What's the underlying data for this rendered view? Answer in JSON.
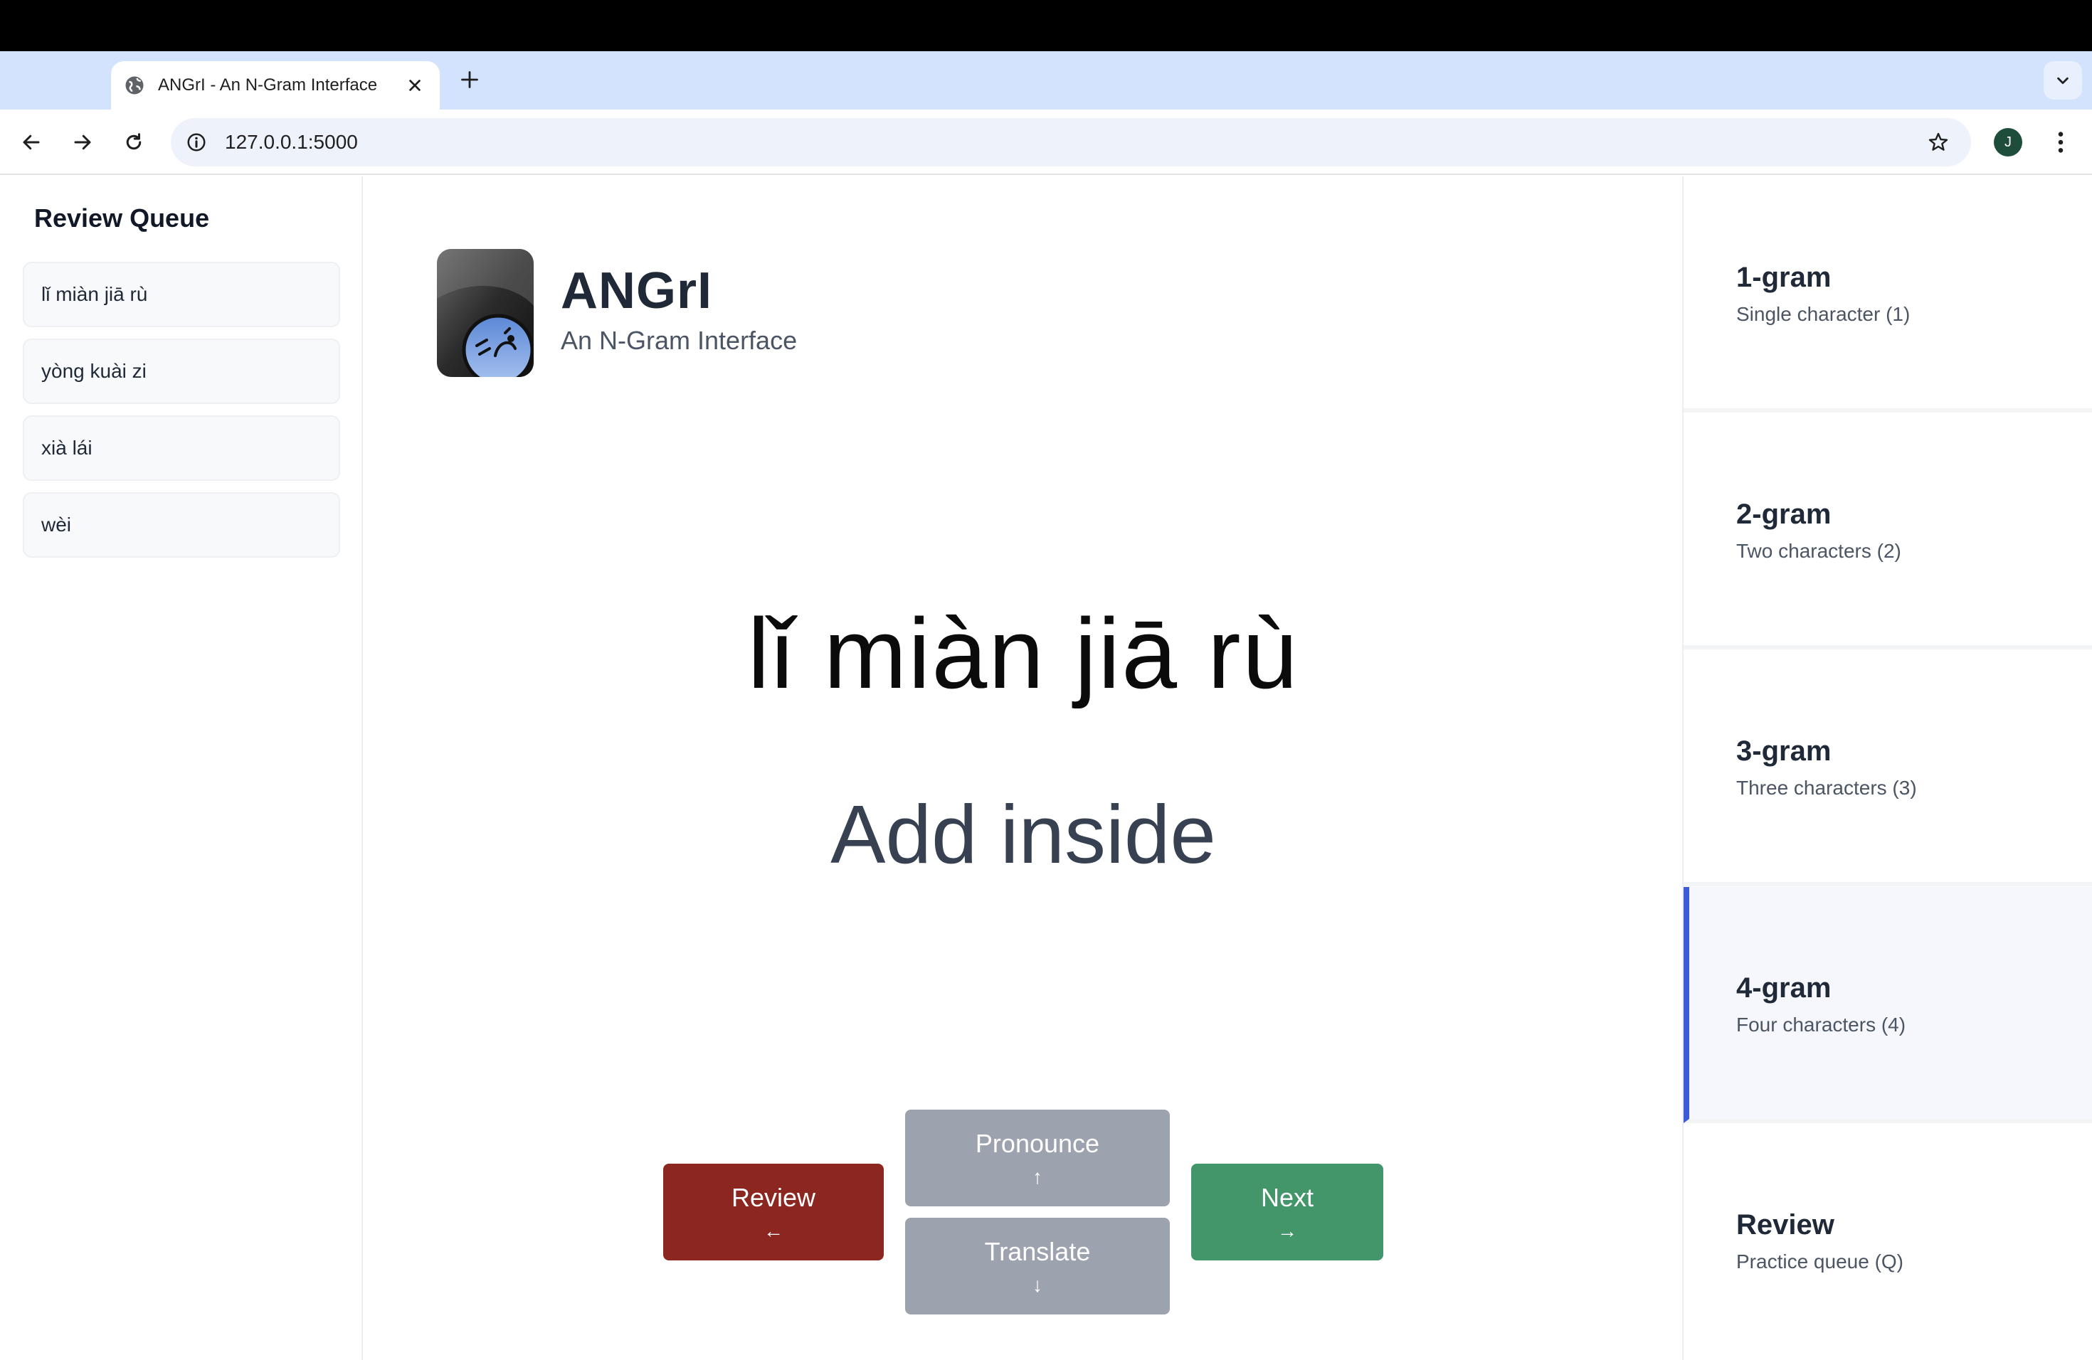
{
  "browser": {
    "tab_title": "ANGrI - An N-Gram Interface",
    "url": "127.0.0.1:5000",
    "avatar_initial": "J"
  },
  "sidebar": {
    "title": "Review Queue",
    "items": [
      {
        "label": "lǐ miàn jiā rù"
      },
      {
        "label": "yòng kuài zi"
      },
      {
        "label": "xià lái"
      },
      {
        "label": "wèi"
      }
    ]
  },
  "brand": {
    "title": "ANGrI",
    "subtitle": "An N-Gram Interface"
  },
  "card": {
    "pinyin": "lǐ miàn jiā rù",
    "meaning": "Add inside"
  },
  "actions": {
    "review": {
      "label": "Review",
      "arrow": "←"
    },
    "pronounce": {
      "label": "Pronounce",
      "arrow": "↑"
    },
    "translate": {
      "label": "Translate",
      "arrow": "↓"
    },
    "next": {
      "label": "Next",
      "arrow": "→"
    }
  },
  "modes": [
    {
      "title": "1-gram",
      "subtitle": "Single character (1)",
      "active": false
    },
    {
      "title": "2-gram",
      "subtitle": "Two characters (2)",
      "active": false
    },
    {
      "title": "3-gram",
      "subtitle": "Three characters (3)",
      "active": false
    },
    {
      "title": "4-gram",
      "subtitle": "Four characters (4)",
      "active": true
    },
    {
      "title": "Review",
      "subtitle": "Practice queue (Q)",
      "active": false
    }
  ],
  "colors": {
    "review_button": "#8c2620",
    "next_button": "#43956a",
    "neutral_button": "#9ca3af",
    "active_mode_accent": "#3b5bdb"
  }
}
